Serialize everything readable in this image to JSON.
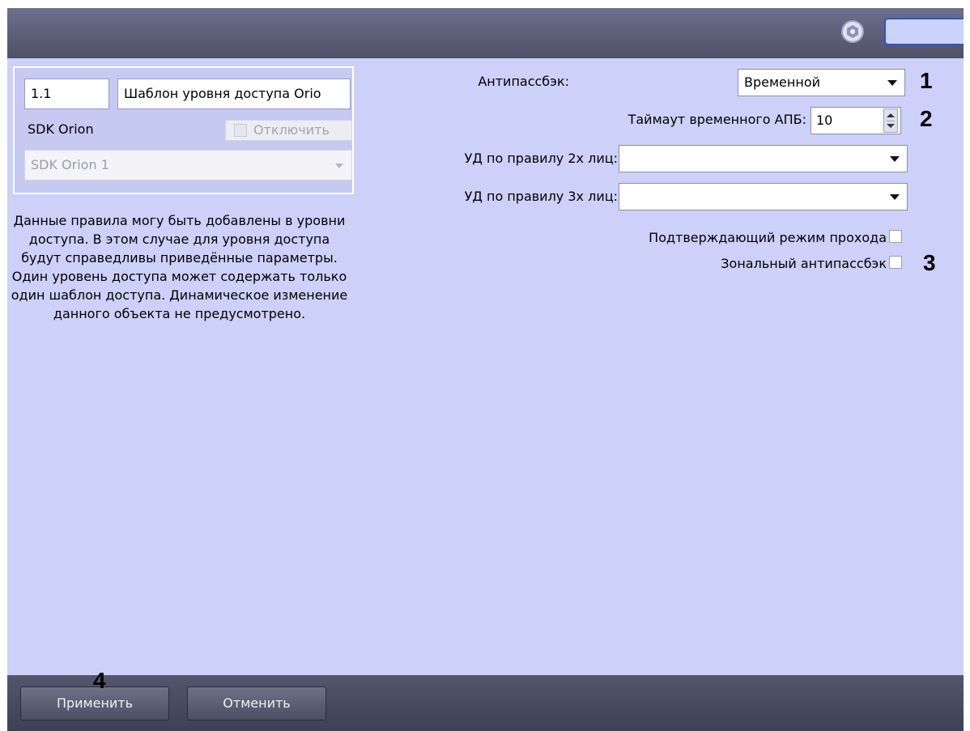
{
  "object_panel": {
    "id_value": "1.1",
    "name_value": "Шаблон уровня доступа Orio",
    "parent_label": "SDK Orion",
    "disable_label": "Отключить",
    "parent_select_value": "SDK Orion 1"
  },
  "description": "Данные правила могу быть добавлены в уровни доступа. В этом случае для уровня доступа будут справедливы приведённые параметры. Один уровень доступа может содержать только один шаблон доступа. Динамическое изменение данного объекта не предусмотрено.",
  "settings": {
    "antipassback_label": "Антипассбэк:",
    "antipassback_value": "Временной",
    "timeout_label": "Таймаут временного АПБ:",
    "timeout_value": "10",
    "two_person_label": "УД по правилу 2х лиц:",
    "two_person_value": "",
    "three_person_label": "УД по правилу 3х лиц:",
    "three_person_value": "",
    "confirm_mode_label": "Подтверждающий режим прохода",
    "zonal_apb_label": "Зональный антипассбэк"
  },
  "markers": {
    "m1": "1",
    "m2": "2",
    "m3": "3",
    "m4": "4"
  },
  "buttons": {
    "apply": "Применить",
    "cancel": "Отменить"
  },
  "colors": {
    "panel_bg": "#cdd0f8",
    "bar_dark": "#4f5169",
    "accent_blue": "#2f55c9"
  }
}
